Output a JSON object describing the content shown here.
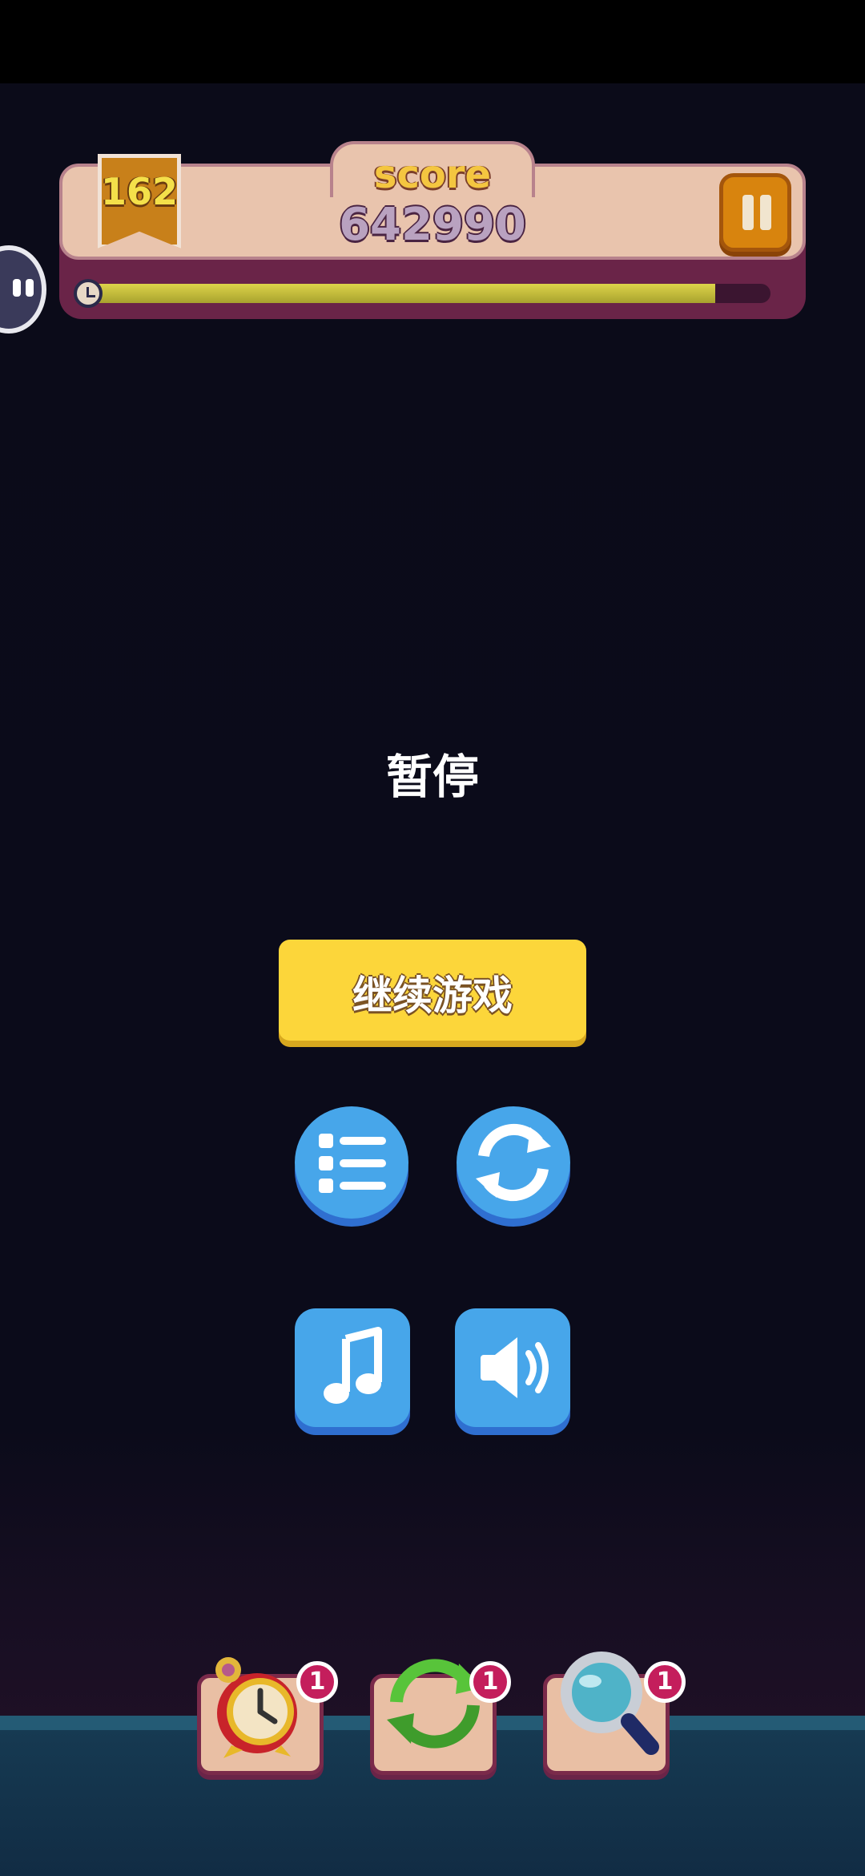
{
  "hud": {
    "level": "162",
    "score_label": "score",
    "score_value": "642990",
    "time_progress": 0.92
  },
  "dialog": {
    "title": "暂停",
    "resume_label": "继续游戏"
  },
  "powerups": [
    {
      "name": "alarm-clock",
      "count": "1"
    },
    {
      "name": "shuffle",
      "count": "1"
    },
    {
      "name": "magnifier",
      "count": "1"
    }
  ],
  "colors": {
    "resume_button": "#fcd63a",
    "control_button": "#47a6ea",
    "badge": "#c41e5c"
  }
}
